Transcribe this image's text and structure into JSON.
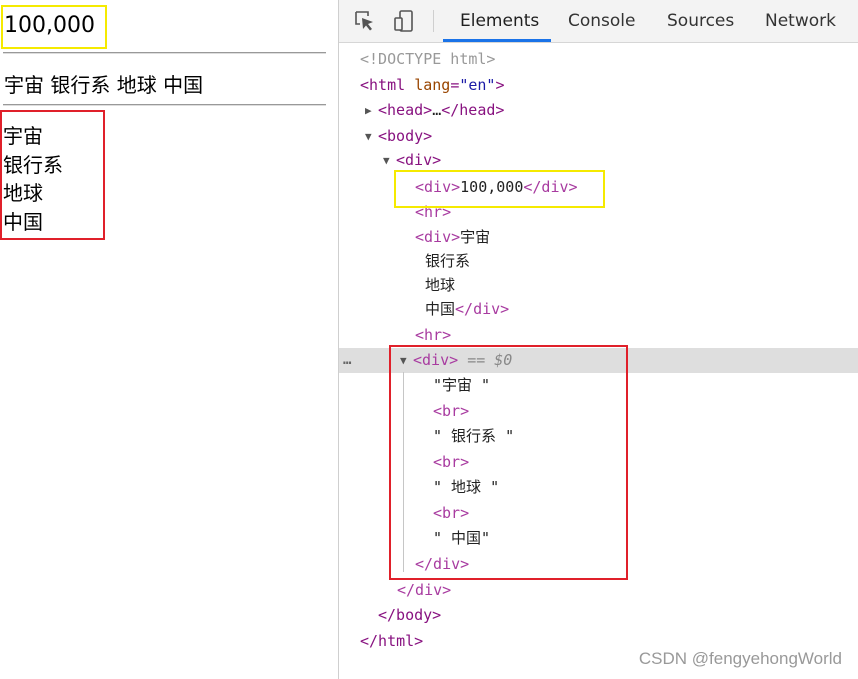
{
  "preview": {
    "number": "100,000",
    "inline_text": "宇宙 银行系 地球 中国",
    "lines": [
      "宇宙",
      "银行系",
      "地球",
      "中国"
    ]
  },
  "devtools": {
    "tabs": [
      "Elements",
      "Console",
      "Sources",
      "Network"
    ],
    "active_tab": "Elements",
    "dom": {
      "doctype": "<!DOCTYPE html>",
      "html_open": "<html",
      "lang_attr": "lang",
      "lang_value": "\"en\"",
      "html_close_bracket": ">",
      "head": "<head>",
      "head_ellipsis": "…",
      "head_close": "</head>",
      "body_open": "<body>",
      "div_open": "<div>",
      "div_close": "</div>",
      "num_text": "100,000",
      "hr": "<hr>",
      "div2_line1": "宇宙",
      "div2_line2": "银行系",
      "div2_line3": "地球",
      "div2_line4": "中国",
      "selected_marker": "== $0",
      "text_node_1": "\"宇宙 \"",
      "br": "<br>",
      "text_node_2": "\" 银行系 \"",
      "text_node_3": "\" 地球 \"",
      "text_node_4": "\" 中国\"",
      "body_close": "</body>",
      "html_close": "</html>",
      "ellipsis_menu": "…"
    }
  },
  "watermark": "CSDN @fengyehongWorld",
  "colors": {
    "highlight_yellow": "#f5ea00",
    "highlight_red": "#e0202a",
    "tab_accent": "#1a73e8"
  }
}
